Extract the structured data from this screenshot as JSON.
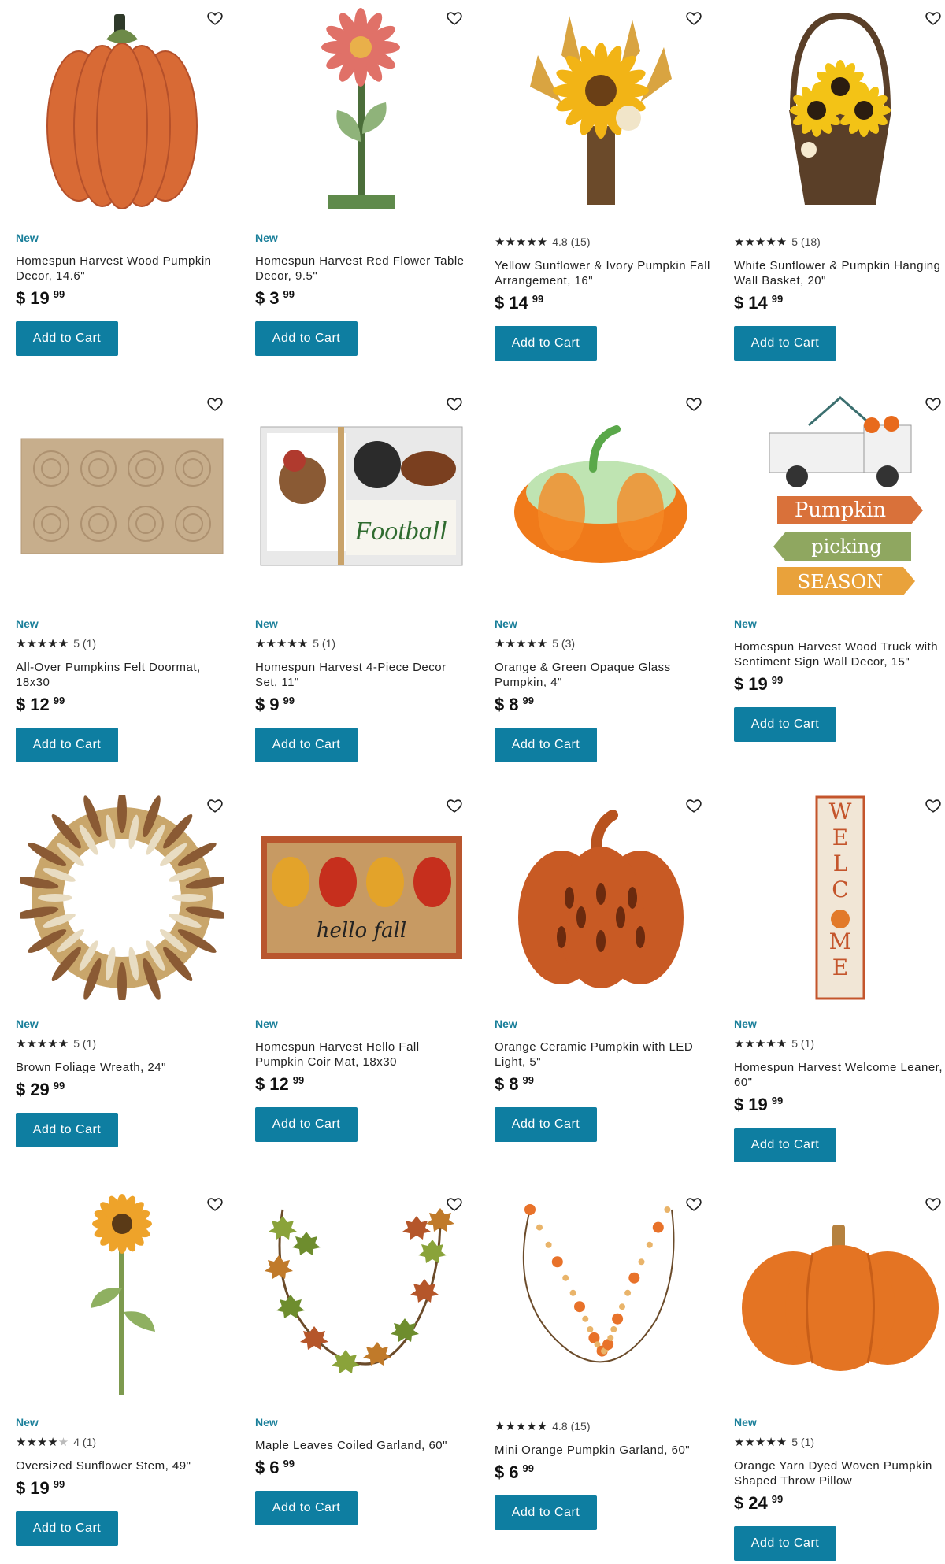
{
  "products": [
    {
      "badge": "New",
      "rating": null,
      "reviews": "",
      "name": "Homespun Harvest Wood Pumpkin Decor, 14.6\"",
      "currency": "$",
      "dollars": "19",
      "cents": "99",
      "button": "Add to Cart",
      "image": "wood-pumpkin-icon"
    },
    {
      "badge": "New",
      "rating": null,
      "reviews": "",
      "name": "Homespun Harvest Red Flower Table Decor, 9.5\"",
      "currency": "$",
      "dollars": "3",
      "cents": "99",
      "button": "Add to Cart",
      "image": "red-flower-icon"
    },
    {
      "badge": "",
      "rating": 4.8,
      "reviews": "4.8 (15)",
      "name": "Yellow Sunflower & Ivory Pumpkin Fall Arrangement, 16\"",
      "currency": "$",
      "dollars": "14",
      "cents": "99",
      "button": "Add to Cart",
      "image": "sunflower-arrangement-icon"
    },
    {
      "badge": "",
      "rating": 5,
      "reviews": "5 (18)",
      "name": "White Sunflower & Pumpkin Hanging Wall Basket, 20\"",
      "currency": "$",
      "dollars": "14",
      "cents": "99",
      "button": "Add to Cart",
      "image": "hanging-basket-icon"
    },
    {
      "badge": "New",
      "rating": 5,
      "reviews": "5 (1)",
      "name": "All-Over Pumpkins Felt Doormat, 18x30",
      "currency": "$",
      "dollars": "12",
      "cents": "99",
      "button": "Add to Cart",
      "image": "felt-doormat-icon"
    },
    {
      "badge": "New",
      "rating": 5,
      "reviews": "5 (1)",
      "name": "Homespun Harvest 4-Piece Decor Set, 11\"",
      "currency": "$",
      "dollars": "9",
      "cents": "99",
      "button": "Add to Cart",
      "image": "decor-set-icon"
    },
    {
      "badge": "New",
      "rating": 5,
      "reviews": "5 (3)",
      "name": "Orange & Green Opaque Glass Pumpkin, 4\"",
      "currency": "$",
      "dollars": "8",
      "cents": "99",
      "button": "Add to Cart",
      "image": "glass-pumpkin-icon"
    },
    {
      "badge": "New",
      "rating": null,
      "reviews": "",
      "name": "Homespun Harvest Wood Truck with Sentiment Sign Wall Decor, 15\"",
      "currency": "$",
      "dollars": "19",
      "cents": "99",
      "button": "Add to Cart",
      "image": "truck-sign-icon"
    },
    {
      "badge": "New",
      "rating": 5,
      "reviews": "5 (1)",
      "name": "Brown Foliage Wreath, 24\"",
      "currency": "$",
      "dollars": "29",
      "cents": "99",
      "button": "Add to Cart",
      "image": "wreath-icon"
    },
    {
      "badge": "New",
      "rating": null,
      "reviews": "",
      "name": "Homespun Harvest Hello Fall Pumpkin Coir Mat, 18x30",
      "currency": "$",
      "dollars": "12",
      "cents": "99",
      "button": "Add to Cart",
      "image": "coir-mat-icon"
    },
    {
      "badge": "New",
      "rating": null,
      "reviews": "",
      "name": "Orange Ceramic Pumpkin with LED Light, 5\"",
      "currency": "$",
      "dollars": "8",
      "cents": "99",
      "button": "Add to Cart",
      "image": "ceramic-pumpkin-icon"
    },
    {
      "badge": "New",
      "rating": 5,
      "reviews": "5 (1)",
      "name": "Homespun Harvest Welcome Leaner, 60\"",
      "currency": "$",
      "dollars": "19",
      "cents": "99",
      "button": "Add to Cart",
      "image": "welcome-leaner-icon"
    },
    {
      "badge": "New",
      "rating": 4,
      "reviews": "4 (1)",
      "name": "Oversized Sunflower Stem, 49\"",
      "currency": "$",
      "dollars": "19",
      "cents": "99",
      "button": "Add to Cart",
      "image": "sunflower-stem-icon"
    },
    {
      "badge": "New",
      "rating": null,
      "reviews": "",
      "name": "Maple Leaves Coiled Garland, 60\"",
      "currency": "$",
      "dollars": "6",
      "cents": "99",
      "button": "Add to Cart",
      "image": "maple-garland-icon"
    },
    {
      "badge": "",
      "rating": 4.8,
      "reviews": "4.8 (15)",
      "name": "Mini Orange Pumpkin Garland, 60\"",
      "currency": "$",
      "dollars": "6",
      "cents": "99",
      "button": "Add to Cart",
      "image": "pumpkin-garland-icon"
    },
    {
      "badge": "New",
      "rating": 5,
      "reviews": "5 (1)",
      "name": "Orange Yarn Dyed Woven Pumpkin Shaped Throw Pillow",
      "currency": "$",
      "dollars": "24",
      "cents": "99",
      "button": "Add to Cart",
      "image": "pumpkin-pillow-icon"
    }
  ]
}
